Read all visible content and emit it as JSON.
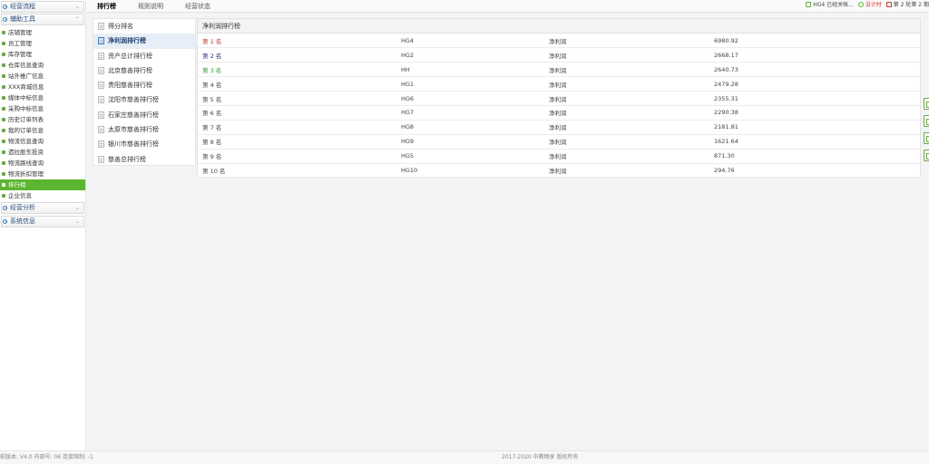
{
  "sidebar": {
    "sections": [
      {
        "label": "经营流程"
      },
      {
        "label": "辅助工具"
      }
    ],
    "items": [
      {
        "label": "店铺管理"
      },
      {
        "label": "员工管理"
      },
      {
        "label": "库存管理"
      },
      {
        "label": "仓库信息查询"
      },
      {
        "label": "站外推广信息"
      },
      {
        "label": "XXX商城信息"
      },
      {
        "label": "媒体中标信息"
      },
      {
        "label": "采购中标信息"
      },
      {
        "label": "历史订单列表"
      },
      {
        "label": "我的订单信息"
      },
      {
        "label": "物流信息查询"
      },
      {
        "label": "遗拉股东投资"
      },
      {
        "label": "物流路线查询"
      },
      {
        "label": "物流折扣管理"
      },
      {
        "label": "排行榜"
      },
      {
        "label": "企业信息"
      }
    ],
    "bottom_sections": [
      {
        "label": "经营分析"
      },
      {
        "label": "系统信息"
      }
    ]
  },
  "top_tabs": [
    {
      "label": "排行榜"
    },
    {
      "label": "规则说明"
    },
    {
      "label": "经营状态"
    }
  ],
  "status": {
    "message": "HG4 已经关帐...",
    "timer_label": "没计时",
    "round": "第 2 轮第 2 期"
  },
  "rank_list": [
    {
      "label": "得分排名"
    },
    {
      "label": "净利润排行榜"
    },
    {
      "label": "资产总计排行榜"
    },
    {
      "label": "北京慈善排行榜"
    },
    {
      "label": "贵阳慈善排行榜"
    },
    {
      "label": "沈阳市慈善排行榜"
    },
    {
      "label": "石家庄慈善排行榜"
    },
    {
      "label": "太原市慈善排行榜"
    },
    {
      "label": "银川市慈善排行榜"
    },
    {
      "label": "慈善总排行榜"
    }
  ],
  "table": {
    "title": "净利润排行榜",
    "rows": [
      {
        "rank": "第 1 名",
        "team": "HG4",
        "metric": "净利润",
        "value": "6980.92",
        "color": "#c0392b"
      },
      {
        "rank": "第 2 名",
        "team": "HG2",
        "metric": "净利润",
        "value": "2668.17",
        "color": "#1f2f8c"
      },
      {
        "rank": "第 3 名",
        "team": "HH",
        "metric": "净利润",
        "value": "2640.73",
        "color": "#2e9e2e"
      },
      {
        "rank": "第 4 名",
        "team": "HG1",
        "metric": "净利润",
        "value": "2479.28",
        "color": "#444444"
      },
      {
        "rank": "第 5 名",
        "team": "HG6",
        "metric": "净利润",
        "value": "2355.31",
        "color": "#444444"
      },
      {
        "rank": "第 6 名",
        "team": "HG7",
        "metric": "净利润",
        "value": "2290.38",
        "color": "#444444"
      },
      {
        "rank": "第 7 名",
        "team": "HG8",
        "metric": "净利润",
        "value": "2181.81",
        "color": "#444444"
      },
      {
        "rank": "第 8 名",
        "team": "HG9",
        "metric": "净利润",
        "value": "1621.64",
        "color": "#444444"
      },
      {
        "rank": "第 9 名",
        "team": "HG5",
        "metric": "净利润",
        "value": "871.30",
        "color": "#444444"
      },
      {
        "rank": "第 10 名",
        "team": "HG10",
        "metric": "净利润",
        "value": "294.76",
        "color": "#444444"
      }
    ]
  },
  "footer": {
    "left": "前版本: V4.0 内部号: 06 连接限制: -1",
    "center": "2017-2020 中教畅享 版权所有"
  }
}
